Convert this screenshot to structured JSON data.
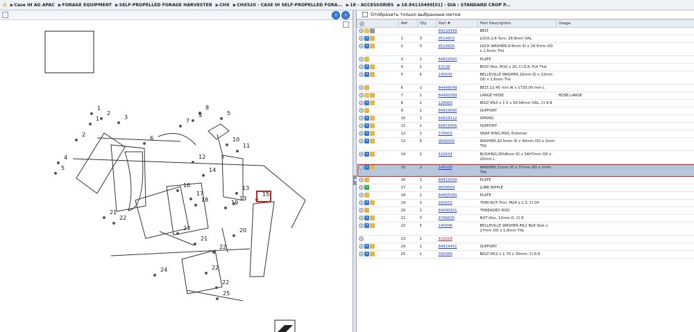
{
  "breadcrumb": {
    "home_icon": "home-icon",
    "items": [
      "Case IH AG APAC",
      "FORAGE EQUIPMENT",
      "SELF-PROPELLED FORAGE HARVESTER",
      "CHX",
      "CHX520 - CASE IH SELF-PROPELLED FORA...",
      "18 - ACCESSORIES",
      "18.84110499[01] - DIA : STANDARD CROP P..."
    ]
  },
  "filter": {
    "label": "Отобразить только выбранные метки",
    "checked": false
  },
  "table": {
    "columns": [
      "",
      "Ref",
      "Qty",
      "Part #",
      "Part Description",
      "Usage"
    ],
    "rows": [
      {
        "icons": [
          "info",
          "folder",
          "wrench"
        ],
        "ref": "",
        "qty": "",
        "part": "84110499",
        "part_color": "blue",
        "desc": "BELT",
        "usage": "",
        "selected": false
      },
      {
        "icons": [
          "info",
          "arrow",
          "box"
        ],
        "ref": "1",
        "qty": "3",
        "part": "9514603",
        "part_color": "blue",
        "desc": "LOCK,1/4 Turn, 28.8mm OAL",
        "usage": "",
        "selected": false
      },
      {
        "icons": [
          "info",
          "arrow",
          "box"
        ],
        "ref": "2",
        "qty": "3",
        "part": "9514605",
        "part_color": "blue",
        "desc": "LOCK WASHER,9.8mm ID x 18.5mm OD x 1.5mm Thk",
        "usage": "",
        "selected": false
      },
      {
        "icons": [
          "info",
          "box"
        ],
        "ref": "3",
        "qty": "1",
        "part": "84819560",
        "part_color": "blue",
        "desc": "PLATE",
        "usage": "",
        "selected": false
      },
      {
        "icons": [
          "info",
          "arrow",
          "box"
        ],
        "ref": "4",
        "qty": "2",
        "part": "43138",
        "part_color": "blue",
        "desc": "BOLT,Hex, M10 x 20, Cl 8.8, Full Thd",
        "usage": "",
        "selected": false
      },
      {
        "icons": [
          "info",
          "arrow",
          "box"
        ],
        "ref": "5",
        "qty": "4",
        "part": "140045",
        "part_color": "blue",
        "desc": "BELLEVILLE WASHER,10mm ID x 22mm OD x 1.6mm Thk",
        "usage": "",
        "selected": false
      },
      {
        "icons": [
          "info",
          "box"
        ],
        "ref": "6",
        "qty": "1",
        "part": "84449048",
        "part_color": "blue",
        "desc": "BELT,12.45 mm W x 1735.00 mm L",
        "usage": "",
        "selected": false
      },
      {
        "icons": [
          "info",
          "folder",
          "box"
        ],
        "ref": "7",
        "qty": "1",
        "part": "84400089",
        "part_color": "blue",
        "desc": "LARGE HOSE",
        "usage": "HOSE,LARGE",
        "selected": false
      },
      {
        "icons": [
          "info",
          "arrow",
          "box"
        ],
        "ref": "8",
        "qty": "2",
        "part": "128069",
        "part_color": "blue",
        "desc": "BOLT,M10 x 1.5 x 56.58mm OAL, Cl 8.8",
        "usage": "",
        "selected": false
      },
      {
        "icons": [
          "info",
          "box"
        ],
        "ref": "9",
        "qty": "1",
        "part": "84819690",
        "part_color": "blue",
        "desc": "SUPPORT",
        "usage": "",
        "selected": false
      },
      {
        "icons": [
          "info",
          "arrow",
          "box"
        ],
        "ref": "10",
        "qty": "1",
        "part": "84818112",
        "part_color": "blue",
        "desc": "SPRING",
        "usage": "",
        "selected": false
      },
      {
        "icons": [
          "info",
          "arrow",
          "box"
        ],
        "ref": "11",
        "qty": "1",
        "part": "84819456",
        "part_color": "blue",
        "desc": "SUPPORT",
        "usage": "",
        "selected": false
      },
      {
        "icons": [
          "info",
          "arrow",
          "box"
        ],
        "ref": "12",
        "qty": "1",
        "part": "378003",
        "part_color": "blue",
        "desc": "SNAP RING,M30, External",
        "usage": "",
        "selected": false
      },
      {
        "icons": [
          "info",
          "arrow",
          "box"
        ],
        "ref": "13",
        "qty": "5",
        "part": "9838356",
        "part_color": "blue",
        "desc": "WASHER,30.5mm ID x 40mm OD x 2mm Thk",
        "usage": "",
        "selected": false
      },
      {
        "icons": [
          "info",
          "arrow",
          "box"
        ],
        "ref": "14",
        "qty": "2",
        "part": "420434",
        "part_color": "blue",
        "desc": "BUSHING,30h8mm ID x 34H7mm OD x 20mm L",
        "usage": "",
        "selected": false
      },
      {
        "icons": [
          "info",
          "arrow",
          "box"
        ],
        "ref": "15",
        "qty": "2",
        "part": "146108",
        "part_color": "blue",
        "desc": "WASHER,31mm ID x 37mm OD x 1mm Thk",
        "usage": "",
        "selected": true
      },
      {
        "icons": [
          "info",
          "box"
        ],
        "ref": "16",
        "qty": "1",
        "part": "84819558",
        "part_color": "blue",
        "desc": "PLATE",
        "usage": "",
        "selected": false
      },
      {
        "icons": [
          "info",
          "green"
        ],
        "ref": "17",
        "qty": "1",
        "part": "9838669",
        "part_color": "blue",
        "desc": "LUBE NIPPLE",
        "usage": "",
        "selected": false
      },
      {
        "icons": [
          "info",
          "box"
        ],
        "ref": "18",
        "qty": "1",
        "part": "84455090",
        "part_color": "blue",
        "desc": "PLATE",
        "usage": "",
        "selected": false
      },
      {
        "icons": [
          "info",
          "arrow",
          "box"
        ],
        "ref": "19",
        "qty": "1",
        "part": "100033",
        "part_color": "blue",
        "desc": "THIN NUT,Thin, M24 x 1.5, Cl 04",
        "usage": "",
        "selected": false
      },
      {
        "icons": [
          "info",
          "box"
        ],
        "ref": "20",
        "qty": "1",
        "part": "84000921",
        "part_color": "blue",
        "desc": "THREADED ROD",
        "usage": "",
        "selected": false
      },
      {
        "icons": [
          "info",
          "arrow",
          "box"
        ],
        "ref": "21",
        "qty": "3",
        "part": "9796605",
        "part_color": "blue",
        "desc": "NUT,Hex, 12mm D, Cl 8",
        "usage": "",
        "selected": false
      },
      {
        "icons": [
          "info",
          "arrow",
          "box"
        ],
        "ref": "22",
        "qty": "5",
        "part": "140046",
        "part_color": "blue",
        "desc": "BELLEVILLE WASHER,M12 Bolt Size x 27mm OD x 1.8mm Thk",
        "usage": "",
        "selected": false
      },
      {
        "icons": [
          "info"
        ],
        "ref": "23",
        "qty": "1",
        "part": "412024",
        "part_color": "red",
        "desc": "",
        "usage": "",
        "selected": false
      },
      {
        "icons": [
          "info",
          "arrow",
          "box"
        ],
        "ref": "24",
        "qty": "1",
        "part": "84819451",
        "part_color": "blue",
        "desc": "SUPPORT",
        "usage": "",
        "selected": false
      },
      {
        "icons": [
          "info",
          "arrow",
          "box"
        ],
        "ref": "25",
        "qty": "2",
        "part": "300389",
        "part_color": "blue",
        "desc": "BOLT,M12 x 1.75 x 35mm, Cl 8.8",
        "usage": "",
        "selected": false
      }
    ]
  },
  "diagram": {
    "callouts": [
      "1",
      "2",
      "3",
      "2",
      "1",
      "4",
      "5",
      "6",
      "7",
      "8",
      "9",
      "5",
      "10",
      "11",
      "12",
      "13",
      "14",
      "16",
      "17",
      "18",
      "19",
      "13",
      "15",
      "20",
      "21",
      "22",
      "23",
      "21",
      "22",
      "22",
      "24",
      "22",
      "25"
    ],
    "highlighted_callout": "15"
  },
  "colors": {
    "accent": "#3d7fd6",
    "highlight": "#d42020",
    "selected_row": "#b7c7db",
    "link": "#1f3fd0"
  }
}
